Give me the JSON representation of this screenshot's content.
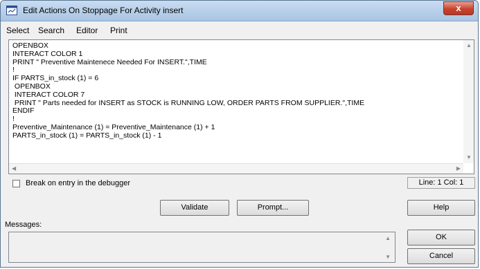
{
  "window": {
    "title": "Edit Actions On Stoppage For Activity insert",
    "close_glyph": "x"
  },
  "menu": {
    "items": [
      "Select",
      "Search",
      "Editor",
      "Print"
    ]
  },
  "editor": {
    "lines": [
      "OPENBOX",
      "INTERACT COLOR 1",
      "PRINT \" Preventive Maintenece Needed For INSERT.\",TIME",
      "!",
      "IF PARTS_in_stock (1) = 6",
      " OPENBOX",
      " INTERACT COLOR 7",
      " PRINT \" Parts needed for INSERT as STOCK is RUNNING LOW, ORDER PARTS FROM SUPPLIER.\",TIME",
      "ENDIF",
      "!",
      "Preventive_Maintenance (1) = Preventive_Maintenance (1) + 1",
      "PARTS_in_stock (1) = PARTS_in_stock (1) - 1"
    ]
  },
  "debugger_checkbox": {
    "label": "Break on entry in the debugger",
    "checked": false
  },
  "status": {
    "position": "Line: 1 Col: 1"
  },
  "buttons": {
    "validate": "Validate",
    "prompt": "Prompt...",
    "help": "Help",
    "ok": "OK",
    "cancel": "Cancel"
  },
  "messages": {
    "label": "Messages:"
  },
  "icons": {
    "app": "window-app-icon",
    "close": "close-icon",
    "scroll_up": "scroll-up-arrow-icon",
    "scroll_down": "scroll-down-arrow-icon",
    "scroll_left": "scroll-left-arrow-icon",
    "scroll_right": "scroll-right-arrow-icon"
  },
  "colors": {
    "titlebar": "#b4cde9",
    "close_button": "#c7432f",
    "dialog_background": "#f0f0f0"
  }
}
